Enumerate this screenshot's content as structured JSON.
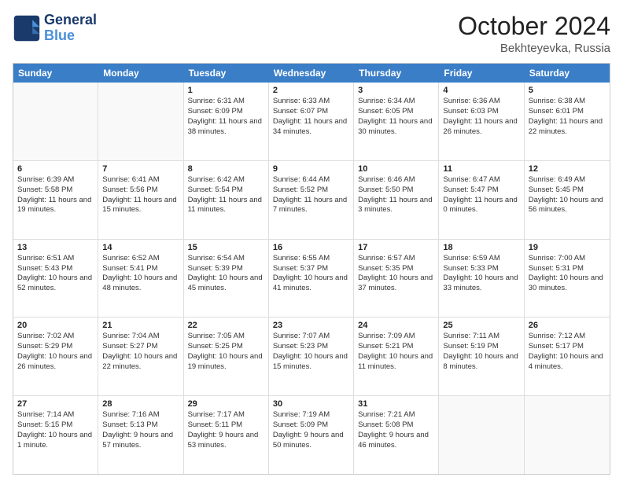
{
  "header": {
    "logo_line1": "General",
    "logo_line2": "Blue",
    "month": "October 2024",
    "location": "Bekhteyevka, Russia"
  },
  "days_of_week": [
    "Sunday",
    "Monday",
    "Tuesday",
    "Wednesday",
    "Thursday",
    "Friday",
    "Saturday"
  ],
  "weeks": [
    [
      {
        "day": "",
        "sunrise": "",
        "sunset": "",
        "daylight": ""
      },
      {
        "day": "",
        "sunrise": "",
        "sunset": "",
        "daylight": ""
      },
      {
        "day": "1",
        "sunrise": "Sunrise: 6:31 AM",
        "sunset": "Sunset: 6:09 PM",
        "daylight": "Daylight: 11 hours and 38 minutes."
      },
      {
        "day": "2",
        "sunrise": "Sunrise: 6:33 AM",
        "sunset": "Sunset: 6:07 PM",
        "daylight": "Daylight: 11 hours and 34 minutes."
      },
      {
        "day": "3",
        "sunrise": "Sunrise: 6:34 AM",
        "sunset": "Sunset: 6:05 PM",
        "daylight": "Daylight: 11 hours and 30 minutes."
      },
      {
        "day": "4",
        "sunrise": "Sunrise: 6:36 AM",
        "sunset": "Sunset: 6:03 PM",
        "daylight": "Daylight: 11 hours and 26 minutes."
      },
      {
        "day": "5",
        "sunrise": "Sunrise: 6:38 AM",
        "sunset": "Sunset: 6:01 PM",
        "daylight": "Daylight: 11 hours and 22 minutes."
      }
    ],
    [
      {
        "day": "6",
        "sunrise": "Sunrise: 6:39 AM",
        "sunset": "Sunset: 5:58 PM",
        "daylight": "Daylight: 11 hours and 19 minutes."
      },
      {
        "day": "7",
        "sunrise": "Sunrise: 6:41 AM",
        "sunset": "Sunset: 5:56 PM",
        "daylight": "Daylight: 11 hours and 15 minutes."
      },
      {
        "day": "8",
        "sunrise": "Sunrise: 6:42 AM",
        "sunset": "Sunset: 5:54 PM",
        "daylight": "Daylight: 11 hours and 11 minutes."
      },
      {
        "day": "9",
        "sunrise": "Sunrise: 6:44 AM",
        "sunset": "Sunset: 5:52 PM",
        "daylight": "Daylight: 11 hours and 7 minutes."
      },
      {
        "day": "10",
        "sunrise": "Sunrise: 6:46 AM",
        "sunset": "Sunset: 5:50 PM",
        "daylight": "Daylight: 11 hours and 3 minutes."
      },
      {
        "day": "11",
        "sunrise": "Sunrise: 6:47 AM",
        "sunset": "Sunset: 5:47 PM",
        "daylight": "Daylight: 11 hours and 0 minutes."
      },
      {
        "day": "12",
        "sunrise": "Sunrise: 6:49 AM",
        "sunset": "Sunset: 5:45 PM",
        "daylight": "Daylight: 10 hours and 56 minutes."
      }
    ],
    [
      {
        "day": "13",
        "sunrise": "Sunrise: 6:51 AM",
        "sunset": "Sunset: 5:43 PM",
        "daylight": "Daylight: 10 hours and 52 minutes."
      },
      {
        "day": "14",
        "sunrise": "Sunrise: 6:52 AM",
        "sunset": "Sunset: 5:41 PM",
        "daylight": "Daylight: 10 hours and 48 minutes."
      },
      {
        "day": "15",
        "sunrise": "Sunrise: 6:54 AM",
        "sunset": "Sunset: 5:39 PM",
        "daylight": "Daylight: 10 hours and 45 minutes."
      },
      {
        "day": "16",
        "sunrise": "Sunrise: 6:55 AM",
        "sunset": "Sunset: 5:37 PM",
        "daylight": "Daylight: 10 hours and 41 minutes."
      },
      {
        "day": "17",
        "sunrise": "Sunrise: 6:57 AM",
        "sunset": "Sunset: 5:35 PM",
        "daylight": "Daylight: 10 hours and 37 minutes."
      },
      {
        "day": "18",
        "sunrise": "Sunrise: 6:59 AM",
        "sunset": "Sunset: 5:33 PM",
        "daylight": "Daylight: 10 hours and 33 minutes."
      },
      {
        "day": "19",
        "sunrise": "Sunrise: 7:00 AM",
        "sunset": "Sunset: 5:31 PM",
        "daylight": "Daylight: 10 hours and 30 minutes."
      }
    ],
    [
      {
        "day": "20",
        "sunrise": "Sunrise: 7:02 AM",
        "sunset": "Sunset: 5:29 PM",
        "daylight": "Daylight: 10 hours and 26 minutes."
      },
      {
        "day": "21",
        "sunrise": "Sunrise: 7:04 AM",
        "sunset": "Sunset: 5:27 PM",
        "daylight": "Daylight: 10 hours and 22 minutes."
      },
      {
        "day": "22",
        "sunrise": "Sunrise: 7:05 AM",
        "sunset": "Sunset: 5:25 PM",
        "daylight": "Daylight: 10 hours and 19 minutes."
      },
      {
        "day": "23",
        "sunrise": "Sunrise: 7:07 AM",
        "sunset": "Sunset: 5:23 PM",
        "daylight": "Daylight: 10 hours and 15 minutes."
      },
      {
        "day": "24",
        "sunrise": "Sunrise: 7:09 AM",
        "sunset": "Sunset: 5:21 PM",
        "daylight": "Daylight: 10 hours and 11 minutes."
      },
      {
        "day": "25",
        "sunrise": "Sunrise: 7:11 AM",
        "sunset": "Sunset: 5:19 PM",
        "daylight": "Daylight: 10 hours and 8 minutes."
      },
      {
        "day": "26",
        "sunrise": "Sunrise: 7:12 AM",
        "sunset": "Sunset: 5:17 PM",
        "daylight": "Daylight: 10 hours and 4 minutes."
      }
    ],
    [
      {
        "day": "27",
        "sunrise": "Sunrise: 7:14 AM",
        "sunset": "Sunset: 5:15 PM",
        "daylight": "Daylight: 10 hours and 1 minute."
      },
      {
        "day": "28",
        "sunrise": "Sunrise: 7:16 AM",
        "sunset": "Sunset: 5:13 PM",
        "daylight": "Daylight: 9 hours and 57 minutes."
      },
      {
        "day": "29",
        "sunrise": "Sunrise: 7:17 AM",
        "sunset": "Sunset: 5:11 PM",
        "daylight": "Daylight: 9 hours and 53 minutes."
      },
      {
        "day": "30",
        "sunrise": "Sunrise: 7:19 AM",
        "sunset": "Sunset: 5:09 PM",
        "daylight": "Daylight: 9 hours and 50 minutes."
      },
      {
        "day": "31",
        "sunrise": "Sunrise: 7:21 AM",
        "sunset": "Sunset: 5:08 PM",
        "daylight": "Daylight: 9 hours and 46 minutes."
      },
      {
        "day": "",
        "sunrise": "",
        "sunset": "",
        "daylight": ""
      },
      {
        "day": "",
        "sunrise": "",
        "sunset": "",
        "daylight": ""
      }
    ]
  ]
}
